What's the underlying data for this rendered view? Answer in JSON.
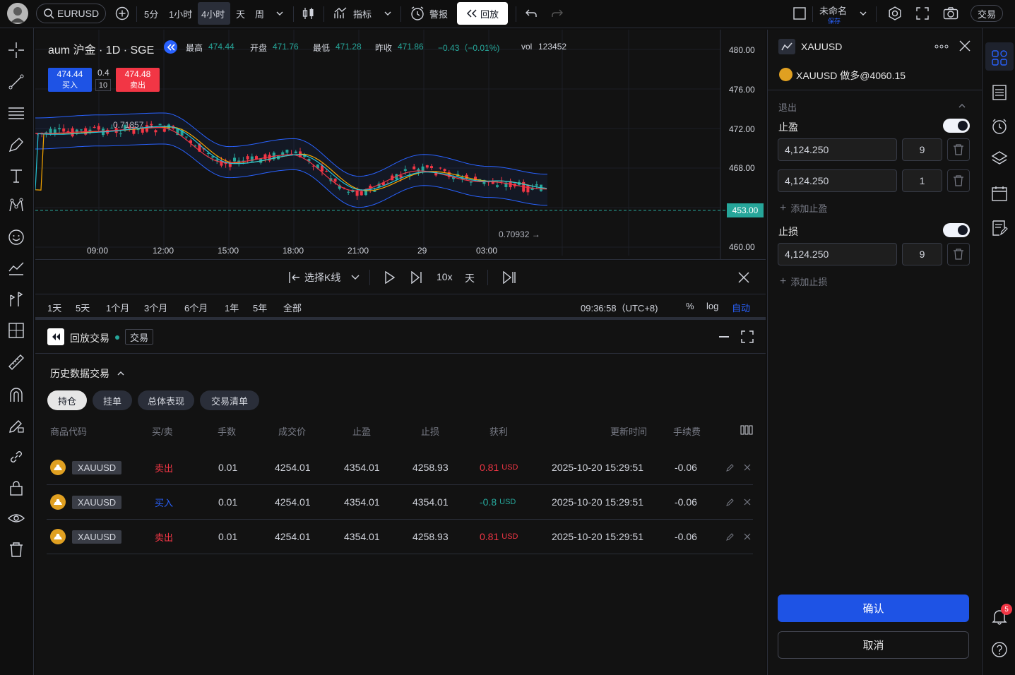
{
  "topbar": {
    "symbol": "EURUSD",
    "intervals": [
      "5分",
      "1小时",
      "4小时",
      "天",
      "周"
    ],
    "active_interval": "4小时",
    "indicators_label": "指标",
    "alert_label": "警报",
    "replay_label": "回放",
    "layout_name": "未命名",
    "layout_status": "保存",
    "trade_label": "交易"
  },
  "chart": {
    "title": "aum 沪金 · 1D · SGE",
    "ohlc": {
      "high_label": "最高",
      "high": "474.44",
      "open_label": "开盘",
      "open": "471.76",
      "low_label": "最低",
      "low": "471.28",
      "prev_label": "昨收",
      "prev": "471.86",
      "change": "−0.43（−0.01%)",
      "vol_label": "vol",
      "vol": "123452"
    },
    "buy_price": "474.44",
    "buy_label": "买入",
    "spread_top": "0.4",
    "spread_qty": "10",
    "sell_price": "474.48",
    "sell_label": "卖出",
    "annotation_high": "0.71857",
    "annotation_low": "0.70932",
    "current_price": "453.00",
    "price_axis": [
      "480.00",
      "476.00",
      "472.00",
      "468.00",
      "460.00"
    ],
    "time_axis": [
      "09:00",
      "12:00",
      "15:00",
      "18:00",
      "21:00",
      "29",
      "03:00"
    ]
  },
  "chart_data": {
    "type": "line",
    "x": [
      "09:00",
      "12:00",
      "15:00",
      "18:00",
      "21:00",
      "29",
      "03:00"
    ],
    "ylim": [
      460,
      480
    ],
    "series": [
      {
        "values": [
          471.8,
          472.0,
          468.6,
          469.4,
          465.6,
          467.8,
          466.6
        ]
      }
    ]
  },
  "replay": {
    "select_bar": "选择K线",
    "speed": "10x",
    "interval": "天"
  },
  "ranges": {
    "items": [
      "1天",
      "5天",
      "1个月",
      "3个月",
      "6个月",
      "1年",
      "5年",
      "全部"
    ],
    "clock": "09:36:58（UTC+8)",
    "percent": "%",
    "log": "log",
    "auto": "自动"
  },
  "bottom": {
    "title": "回放交易",
    "tag": "交易",
    "section": "历史数据交易",
    "tabs": [
      "持仓",
      "挂单",
      "总体表现",
      "交易清单"
    ],
    "headers": [
      "商品代码",
      "买/卖",
      "手数",
      "成交价",
      "止盈",
      "止损",
      "获利",
      "更新时间",
      "手续费"
    ],
    "rows": [
      {
        "symbol": "XAUUSD",
        "side": "卖出",
        "qty": "0.01",
        "price": "4254.01",
        "tp": "4354.01",
        "sl": "4258.93",
        "pnl": "0.81",
        "unit": "USD",
        "time": "2025-10-20 15:29:51",
        "fee": "-0.06"
      },
      {
        "symbol": "XAUUSD",
        "side": "买入",
        "qty": "0.01",
        "price": "4254.01",
        "tp": "4354.01",
        "sl": "4354.01",
        "pnl": "-0.8",
        "unit": "USD",
        "time": "2025-10-20 15:29:51",
        "fee": "-0.06"
      },
      {
        "symbol": "XAUUSD",
        "side": "卖出",
        "qty": "0.01",
        "price": "4254.01",
        "tp": "4354.01",
        "sl": "4258.93",
        "pnl": "0.81",
        "unit": "USD",
        "time": "2025-10-20 15:29:51",
        "fee": "-0.06"
      }
    ]
  },
  "order": {
    "symbol": "XAUUSD",
    "position": "XAUUSD 做多@4060.15",
    "exit_label": "退出",
    "tp_label": "止盈",
    "tp_rows": [
      {
        "price": "4,124.250",
        "qty": "9"
      },
      {
        "price": "4,124.250",
        "qty": "1"
      }
    ],
    "add_tp": "添加止盈",
    "sl_label": "止损",
    "sl_rows": [
      {
        "price": "4,124.250",
        "qty": "9"
      }
    ],
    "add_sl": "添加止损",
    "confirm": "确认",
    "cancel": "取消"
  },
  "notifications": {
    "count": "5"
  },
  "colors": {
    "up": "#26a69a",
    "down": "#f23645",
    "accent": "#1e53e5"
  }
}
